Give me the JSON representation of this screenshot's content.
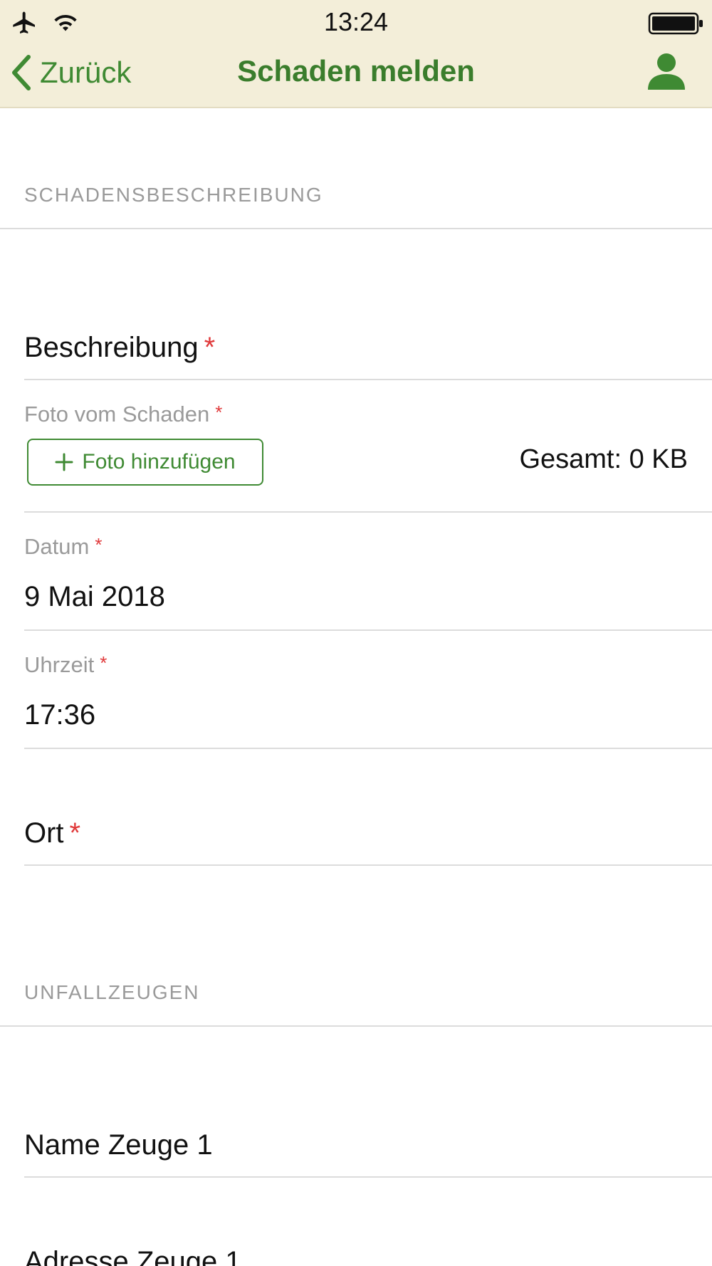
{
  "status_bar": {
    "time": "13:24",
    "icons": [
      "airplane-icon",
      "wifi-icon",
      "battery-icon"
    ]
  },
  "nav": {
    "back_label": "Zurück",
    "title": "Schaden melden",
    "profile_icon": "person-icon"
  },
  "sections": {
    "description_header": "SCHADENSBESCHREIBUNG",
    "witnesses_header": "UNFALLZEUGEN"
  },
  "form": {
    "description": {
      "label": "Beschreibung",
      "required_mark": "*"
    },
    "photo": {
      "label": "Foto vom Schaden",
      "required_mark": "*",
      "add_button_label": "Foto hinzufügen",
      "total_label": "Gesamt: 0 KB"
    },
    "date": {
      "label": "Datum",
      "required_mark": "*",
      "value": "9 Mai 2018"
    },
    "time": {
      "label": "Uhrzeit",
      "required_mark": "*",
      "value": "17:36"
    },
    "location": {
      "label": "Ort",
      "required_mark": "*"
    },
    "witness_name": {
      "label": "Name Zeuge 1"
    },
    "witness_address": {
      "label": "Adresse Zeuge 1"
    }
  },
  "colors": {
    "accent_green": "#3f8a33",
    "header_background": "#f3eed9",
    "required_red": "#e0393a",
    "muted_gray": "#9a9a9a"
  }
}
